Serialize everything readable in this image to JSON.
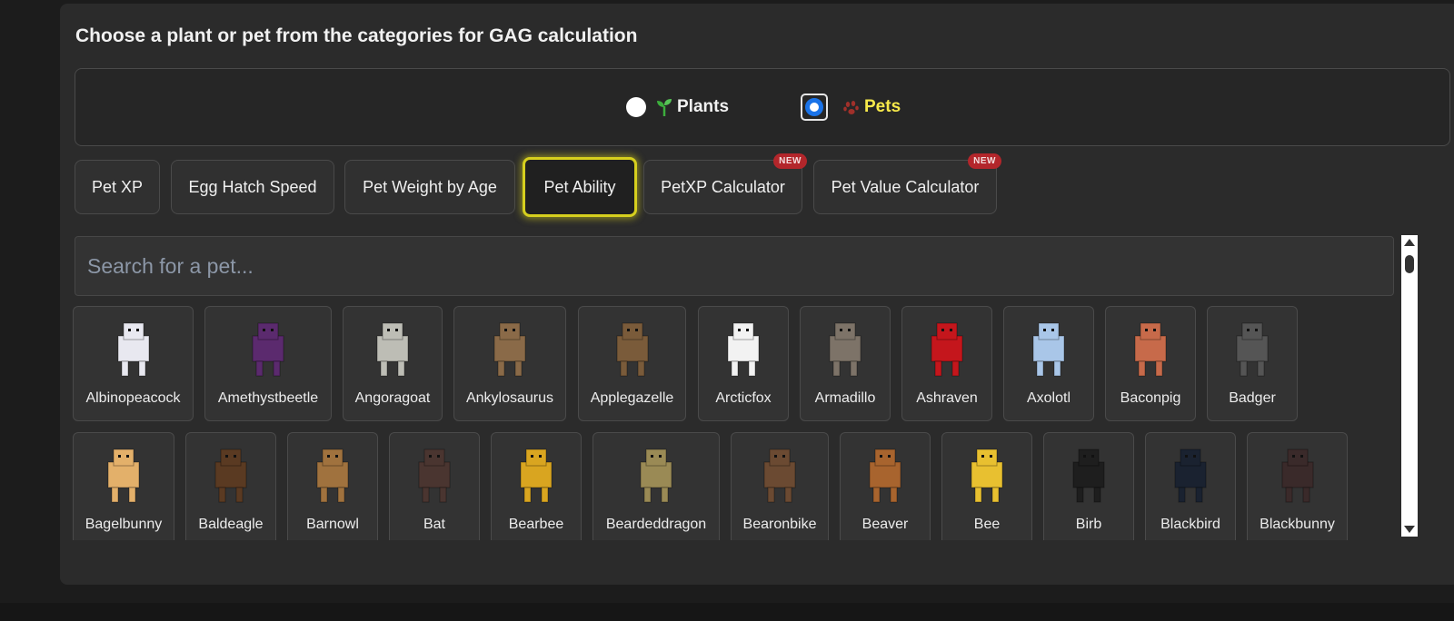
{
  "heading": "Choose a plant or pet from the categories for GAG calculation",
  "mode_toggle": {
    "options": [
      {
        "label": "Plants",
        "selected": false,
        "icon": "sprout-icon"
      },
      {
        "label": "Pets",
        "selected": true,
        "icon": "paw-icon"
      }
    ]
  },
  "tabs": [
    {
      "label": "Pet XP",
      "active": false,
      "new": false
    },
    {
      "label": "Egg Hatch Speed",
      "active": false,
      "new": false
    },
    {
      "label": "Pet Weight by Age",
      "active": false,
      "new": false
    },
    {
      "label": "Pet Ability",
      "active": true,
      "new": false
    },
    {
      "label": "PetXP Calculator",
      "active": false,
      "new": true
    },
    {
      "label": "Pet Value Calculator",
      "active": false,
      "new": true
    }
  ],
  "badge_label": "NEW",
  "search": {
    "placeholder": "Search for a pet...",
    "value": ""
  },
  "pets": [
    {
      "name": "Albinopeacock",
      "icon": "albinopeacock-icon",
      "color": "#e8e8f0"
    },
    {
      "name": "Amethystbeetle",
      "icon": "amethystbeetle-icon",
      "color": "#5b2a6e"
    },
    {
      "name": "Angoragoat",
      "icon": "angoragoat-icon",
      "color": "#bdbdb5"
    },
    {
      "name": "Ankylosaurus",
      "icon": "ankylosaurus-icon",
      "color": "#8a6a48"
    },
    {
      "name": "Applegazelle",
      "icon": "applegazelle-icon",
      "color": "#7a5b3a"
    },
    {
      "name": "Arcticfox",
      "icon": "arcticfox-icon",
      "color": "#f2f2f2"
    },
    {
      "name": "Armadillo",
      "icon": "armadillo-icon",
      "color": "#7d7368"
    },
    {
      "name": "Ashraven",
      "icon": "ashraven-icon",
      "color": "#c4161c"
    },
    {
      "name": "Axolotl",
      "icon": "axolotl-icon",
      "color": "#a9c6e8"
    },
    {
      "name": "Baconpig",
      "icon": "baconpig-icon",
      "color": "#c76a4a"
    },
    {
      "name": "Badger",
      "icon": "badger-icon",
      "color": "#555"
    },
    {
      "name": "Bagelbunny",
      "icon": "bagelbunny-icon",
      "color": "#e3b06a"
    },
    {
      "name": "Baldeagle",
      "icon": "baldeagle-icon",
      "color": "#5a3a22"
    },
    {
      "name": "Barnowl",
      "icon": "barnowl-icon",
      "color": "#a0723e"
    },
    {
      "name": "Bat",
      "icon": "bat-icon",
      "color": "#4a3530"
    },
    {
      "name": "Bearbee",
      "icon": "bearbee-icon",
      "color": "#d9a520"
    },
    {
      "name": "Beardeddragon",
      "icon": "beardeddragon-icon",
      "color": "#9a8a55"
    },
    {
      "name": "Bearonbike",
      "icon": "bearonbike-icon",
      "color": "#6b4a32"
    },
    {
      "name": "Beaver",
      "icon": "beaver-icon",
      "color": "#a8642e"
    },
    {
      "name": "Bee",
      "icon": "bee-icon",
      "color": "#e8c030"
    },
    {
      "name": "Birb",
      "icon": "birb-icon",
      "color": "#1e1e1e"
    },
    {
      "name": "Blackbird",
      "icon": "blackbird-icon",
      "color": "#1a2230"
    },
    {
      "name": "Blackbunny",
      "icon": "blackbunny-icon",
      "color": "#3a2a2a"
    }
  ]
}
